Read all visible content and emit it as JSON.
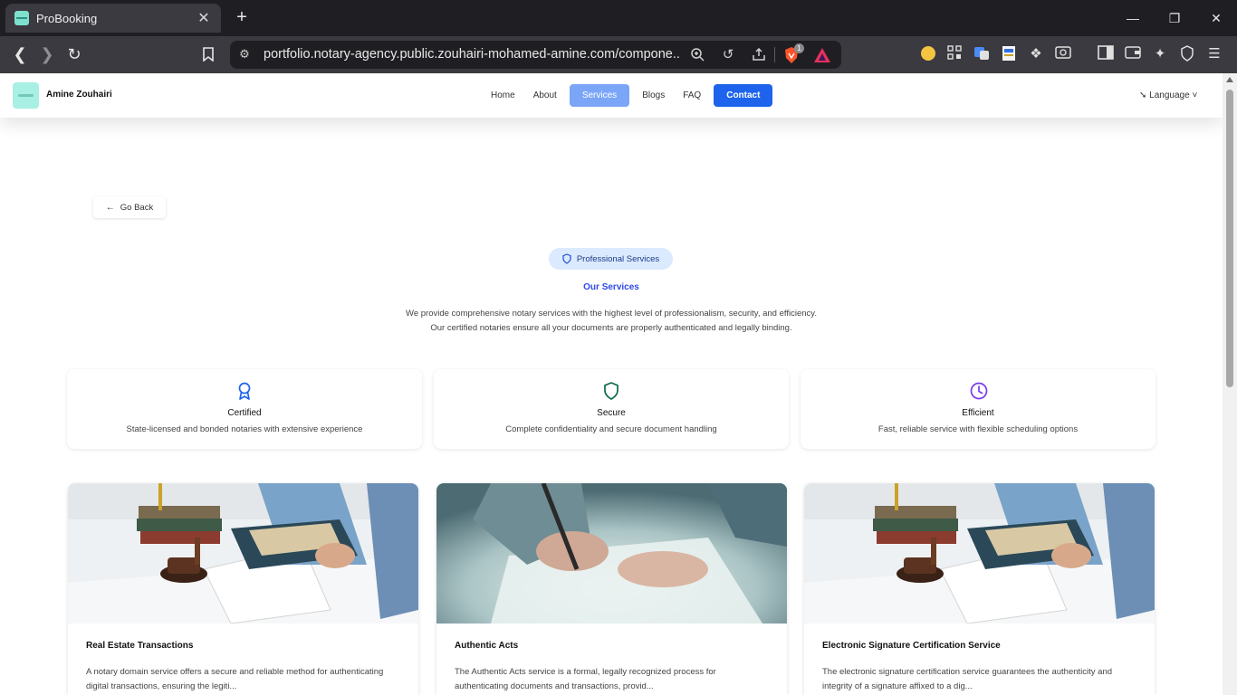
{
  "browser": {
    "tab_title": "ProBooking",
    "url": "portfolio.notary-agency.public.zouhairi-mohamed-amine.com/compone...",
    "brave_shield_count": "1",
    "extension_badge": "2"
  },
  "header": {
    "brand": "Amine Zouhairi",
    "nav": [
      {
        "label": "Home"
      },
      {
        "label": "About"
      },
      {
        "label": "Services"
      },
      {
        "label": "Blogs"
      },
      {
        "label": "FAQ"
      },
      {
        "label": "Contact"
      }
    ],
    "language_label": "Language"
  },
  "go_back_label": "Go Back",
  "badge_label": "Professional Services",
  "section_title": "Our Services",
  "section_description": [
    "We provide comprehensive notary services with the highest level of professionalism, security, and efficiency.",
    "Our certified notaries ensure all your documents are properly authenticated and legally binding."
  ],
  "features": [
    {
      "icon": "award-icon",
      "title": "Certified",
      "description": "State-licensed and bonded notaries with extensive experience",
      "color": "#1d63ec"
    },
    {
      "icon": "shield-icon",
      "title": "Secure",
      "description": "Complete confidentiality and secure document handling",
      "color": "#0f6b4f"
    },
    {
      "icon": "clock-icon",
      "title": "Efficient",
      "description": "Fast, reliable service with flexible scheduling options",
      "color": "#7c3aed"
    }
  ],
  "services": [
    {
      "title": "Real Estate Transactions",
      "description_lines": [
        "A notary domain service offers a secure and reliable method for authenticating",
        "digital transactions, ensuring the legiti..."
      ]
    },
    {
      "title": "Authentic Acts",
      "description_lines": [
        "The Authentic Acts service is a formal, legally recognized process for",
        "authenticating documents and transactions, provid..."
      ]
    },
    {
      "title": "Electronic Signature Certification Service",
      "description_lines": [
        "The electronic signature certification service guarantees the authenticity and",
        "integrity of a signature affixed to a dig..."
      ]
    }
  ],
  "colors": {
    "primary": "#1d63ec",
    "nav_active": "#7ba6f7",
    "title_blue": "#2f49e6",
    "pill_bg": "#dbeafe"
  }
}
